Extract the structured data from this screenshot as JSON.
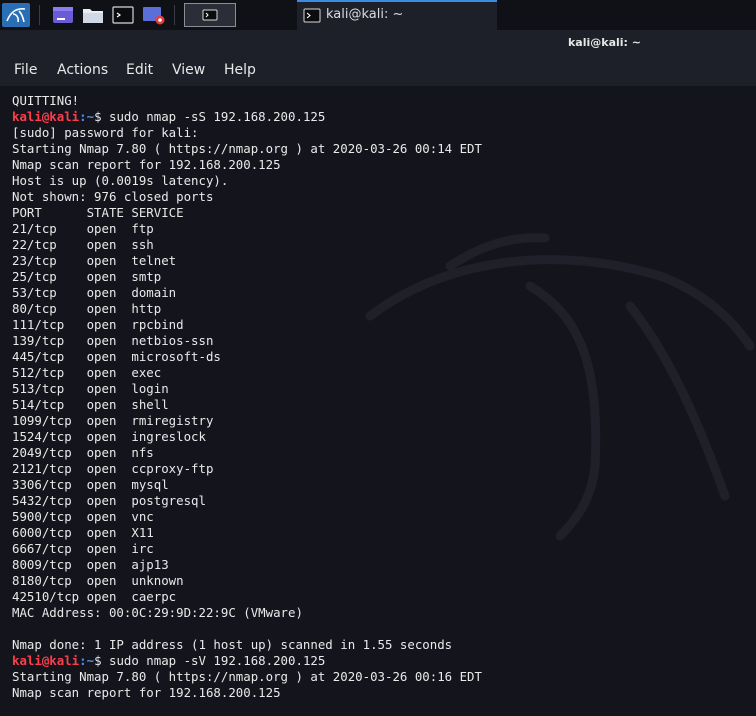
{
  "panel": {
    "task_title": "kali@kali: ~"
  },
  "window": {
    "title": "kali@kali: ~"
  },
  "menu": {
    "file": "File",
    "actions": "Actions",
    "edit": "Edit",
    "view": "View",
    "help": "Help"
  },
  "terminal": {
    "quitting": "QUITTING!",
    "prompt_user": "kali@kali",
    "prompt_path": ":~",
    "prompt_sign": "$ ",
    "cmd1": "sudo nmap -sS 192.168.200.125",
    "sudo_prompt": "[sudo] password for kali:",
    "start1": "Starting Nmap 7.80 ( https://nmap.org ) at 2020-03-26 00:14 EDT",
    "report1": "Nmap scan report for 192.168.200.125",
    "host_up": "Host is up (0.0019s latency).",
    "not_shown": "Not shown: 976 closed ports",
    "header": "PORT      STATE SERVICE",
    "ports": [
      "21/tcp    open  ftp",
      "22/tcp    open  ssh",
      "23/tcp    open  telnet",
      "25/tcp    open  smtp",
      "53/tcp    open  domain",
      "80/tcp    open  http",
      "111/tcp   open  rpcbind",
      "139/tcp   open  netbios-ssn",
      "445/tcp   open  microsoft-ds",
      "512/tcp   open  exec",
      "513/tcp   open  login",
      "514/tcp   open  shell",
      "1099/tcp  open  rmiregistry",
      "1524/tcp  open  ingreslock",
      "2049/tcp  open  nfs",
      "2121/tcp  open  ccproxy-ftp",
      "3306/tcp  open  mysql",
      "5432/tcp  open  postgresql",
      "5900/tcp  open  vnc",
      "6000/tcp  open  X11",
      "6667/tcp  open  irc",
      "8009/tcp  open  ajp13",
      "8180/tcp  open  unknown",
      "42510/tcp open  caerpc"
    ],
    "mac": "MAC Address: 00:0C:29:9D:22:9C (VMware)",
    "done": "Nmap done: 1 IP address (1 host up) scanned in 1.55 seconds",
    "cmd2": "sudo nmap -sV 192.168.200.125",
    "start2": "Starting Nmap 7.80 ( https://nmap.org ) at 2020-03-26 00:16 EDT",
    "report2": "Nmap scan report for 192.168.200.125"
  }
}
